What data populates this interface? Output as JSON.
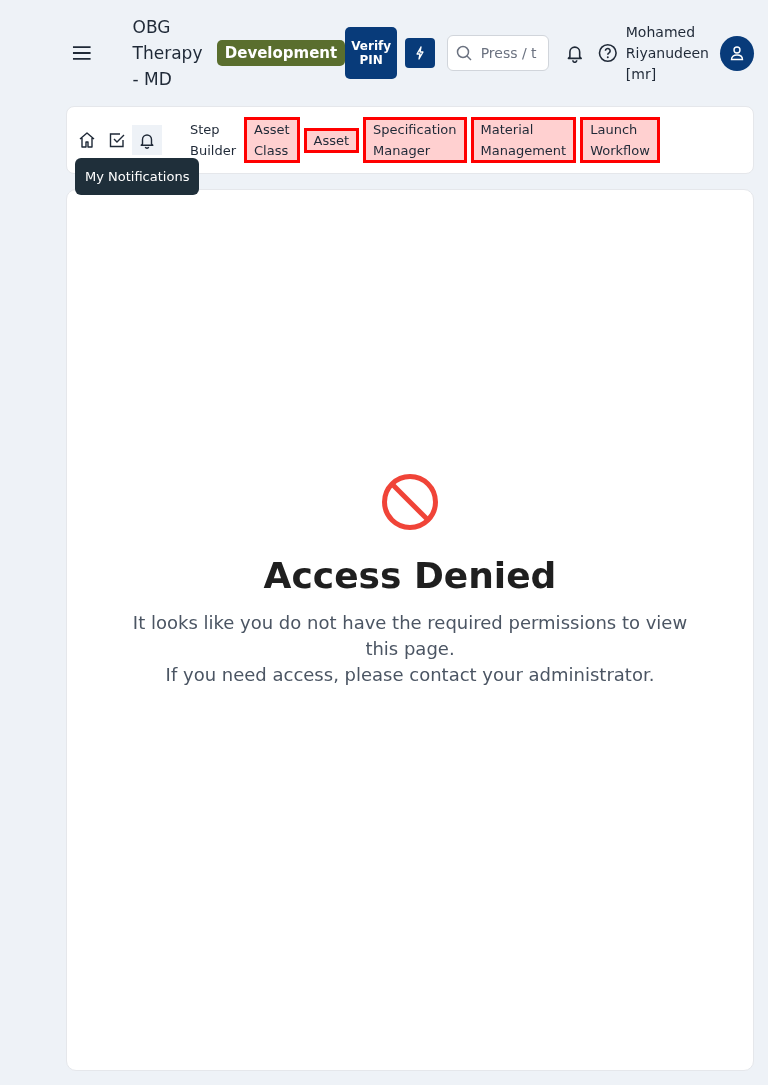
{
  "header": {
    "app_title": "OBG Therapy - MD",
    "environment": "Development",
    "verify_button": "Verify PIN",
    "search": {
      "placeholder": "Press / t"
    },
    "user_name": "Mohamed Riyanudeen [mr]"
  },
  "nav": {
    "icons": [
      {
        "kind": "home",
        "selected": false
      },
      {
        "kind": "tasks",
        "selected": false
      },
      {
        "kind": "bell",
        "selected": true
      }
    ],
    "tooltip": "My Notifications",
    "tabs": [
      {
        "label": "Step Builder",
        "flagged": false
      },
      {
        "label": "Asset Class",
        "flagged": true
      },
      {
        "label": "Asset",
        "flagged": true
      },
      {
        "label": "Specification Manager",
        "flagged": true
      },
      {
        "label": "Material Management",
        "flagged": true
      },
      {
        "label": "Launch Workflow",
        "flagged": true
      }
    ]
  },
  "message": {
    "title": "Access Denied",
    "lines": [
      "It looks like you do not have the required permissions to view this page.",
      "If you need access, please contact your administrator."
    ]
  }
}
